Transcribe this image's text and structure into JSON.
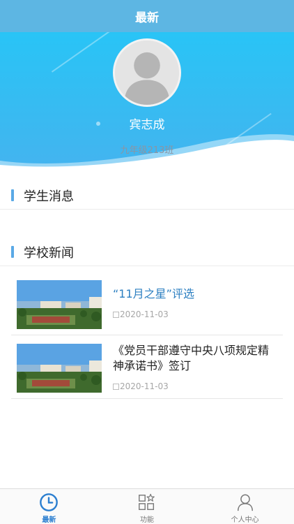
{
  "header": {
    "title": "最新"
  },
  "profile": {
    "name": "宾志成",
    "class_name": "九年级213班"
  },
  "sections": {
    "student_messages": "学生消息",
    "school_news": "学校新闻"
  },
  "news": [
    {
      "title": "“11月之星”评选",
      "date": "2020-11-03"
    },
    {
      "title": "《党员干部遵守中央八项规定精神承诺书》签订",
      "date": "2020-11-03"
    }
  ],
  "tabs": [
    {
      "label": "最新",
      "icon": "clock-icon",
      "active": true
    },
    {
      "label": "功能",
      "icon": "grid-star-icon",
      "active": false
    },
    {
      "label": "个人中心",
      "icon": "person-icon",
      "active": false
    }
  ],
  "colors": {
    "accent": "#2c7fd0",
    "header": "#5db6e3",
    "hero": "#39baf1",
    "link": "#2c7fc1"
  }
}
